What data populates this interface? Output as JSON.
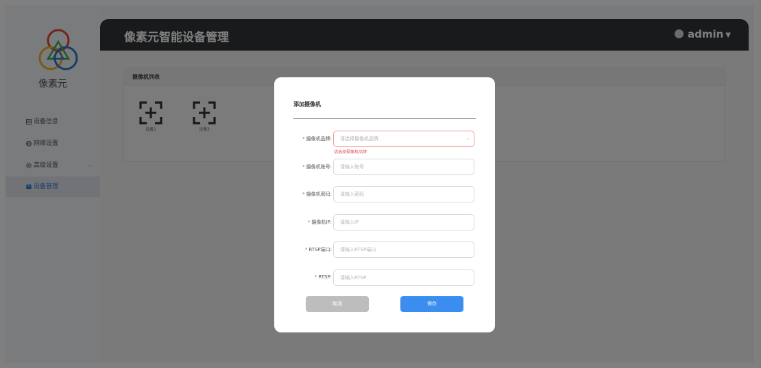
{
  "app": {
    "brand": "像素元",
    "title": "像素元智能设备管理",
    "user": "admin"
  },
  "sidebar": {
    "items": [
      {
        "label": "设备信息",
        "icon": "list-icon"
      },
      {
        "label": "网络设置",
        "icon": "globe-icon"
      },
      {
        "label": "高级设置",
        "icon": "gear-icon"
      },
      {
        "label": "设备管理",
        "icon": "device-icon",
        "active": true
      }
    ]
  },
  "camera_panel": {
    "title": "摄像机列表",
    "cameras": [
      {
        "label": "设备1",
        "icon": "add-camera-icon"
      },
      {
        "label": "设备2",
        "icon": "add-camera-icon"
      }
    ]
  },
  "modal": {
    "title": "添加摄像机",
    "fields": [
      {
        "label": "摄像机品牌:",
        "placeholder": "请选择摄像机品牌",
        "type": "select",
        "error": "请选择摄像机品牌"
      },
      {
        "label": "摄像机账号:",
        "placeholder": "请输入账号"
      },
      {
        "label": "摄像机密码:",
        "placeholder": "请输入密码"
      },
      {
        "label": "摄像机IP:",
        "placeholder": "请输入IP"
      },
      {
        "label": "RTSP端口:",
        "placeholder": "请输入RTSP端口"
      },
      {
        "label": "RTSP:",
        "placeholder": "请输入RTSP"
      }
    ],
    "cancel_label": "取消",
    "save_label": "保存"
  },
  "colors": {
    "header_bg": "#333539",
    "accent": "#3b8ef0",
    "error": "#e05555",
    "logo_red": "#e4473f",
    "logo_blue": "#2c79d1",
    "logo_yellow": "#f0b429",
    "logo_green": "#3fae54"
  }
}
